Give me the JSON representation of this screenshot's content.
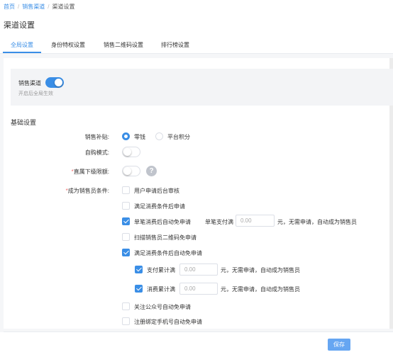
{
  "breadcrumb": {
    "home": "首页",
    "parent": "销售渠道",
    "current": "渠道设置",
    "separator": "/"
  },
  "page_title": "渠道设置",
  "tabs": [
    {
      "label": "全局设置",
      "active": true
    },
    {
      "label": "身份特权设置",
      "active": false
    },
    {
      "label": "销售二维码设置",
      "active": false
    },
    {
      "label": "排行榜设置",
      "active": false
    }
  ],
  "channel": {
    "label": "销售渠道",
    "enabled": true,
    "description": "开启后全局生效"
  },
  "basic": {
    "title": "基础设置",
    "subsidy": {
      "label": "销售补贴:",
      "options": [
        "零钱",
        "平台积分"
      ],
      "selected": "零钱"
    },
    "self_purchase": {
      "label": "自购模式:",
      "enabled": false
    },
    "direct_limit": {
      "label": "直属下级限额:",
      "required_mark": "*",
      "enabled": false,
      "help_icon": "?"
    },
    "conditions": {
      "label": "成为销售员条件:",
      "required_mark": "*",
      "items": [
        {
          "label": "用户申请后台审核",
          "checked": false
        },
        {
          "label": "满足消费条件后申请",
          "checked": false
        },
        {
          "label": "单笔消费后自动免申请",
          "checked": true,
          "extra_label": "单笔支付满",
          "value": "",
          "placeholder": "0.00",
          "suffix": "元，无需申请，自动成为销售员"
        },
        {
          "label": "扫描销售员二维码免申请",
          "checked": false
        },
        {
          "label": "满足消费条件后自动免申请",
          "checked": true
        },
        {
          "label": "支付累计满",
          "checked": true,
          "value": "",
          "placeholder": "0.00",
          "suffix": "元，无需申请，自动成为销售员"
        },
        {
          "label": "消费累计满",
          "checked": true,
          "value": "",
          "placeholder": "0.00",
          "suffix": "元，无需申请，自动成为销售员"
        },
        {
          "label": "关注公众号自动免申请",
          "checked": false
        },
        {
          "label": "注册绑定手机号自动免申请",
          "checked": false
        }
      ]
    }
  },
  "footer": {
    "save_label": "保存"
  },
  "colors": {
    "accent": "#3a8ee6",
    "panel_bg": "#f5f6f8",
    "required": "#f56c6c"
  }
}
